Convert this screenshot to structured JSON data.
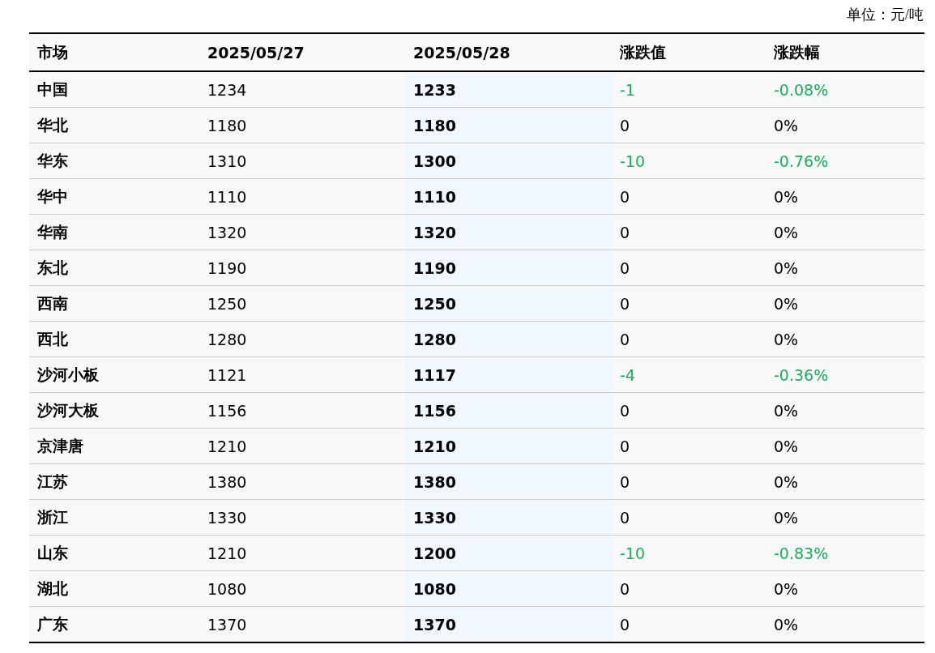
{
  "unit": "单位：元/吨",
  "columns": [
    "市场",
    "2025/05/27",
    "2025/05/28",
    "涨跌值",
    "涨跌幅"
  ],
  "rows": [
    {
      "market": "中国",
      "prev": "1234",
      "curr": "1233",
      "change": "-1",
      "pct": "-0.08%",
      "color": "#1aad5a"
    },
    {
      "market": "华北",
      "prev": "1180",
      "curr": "1180",
      "change": "0",
      "pct": "0%",
      "color": "#000000"
    },
    {
      "market": "华东",
      "prev": "1310",
      "curr": "1300",
      "change": "-10",
      "pct": "-0.76%",
      "color": "#1aad5a"
    },
    {
      "market": "华中",
      "prev": "1110",
      "curr": "1110",
      "change": "0",
      "pct": "0%",
      "color": "#000000"
    },
    {
      "market": "华南",
      "prev": "1320",
      "curr": "1320",
      "change": "0",
      "pct": "0%",
      "color": "#000000"
    },
    {
      "market": "东北",
      "prev": "1190",
      "curr": "1190",
      "change": "0",
      "pct": "0%",
      "color": "#000000"
    },
    {
      "market": "西南",
      "prev": "1250",
      "curr": "1250",
      "change": "0",
      "pct": "0%",
      "color": "#000000"
    },
    {
      "market": "西北",
      "prev": "1280",
      "curr": "1280",
      "change": "0",
      "pct": "0%",
      "color": "#000000"
    },
    {
      "market": "沙河小板",
      "prev": "1121",
      "curr": "1117",
      "change": "-4",
      "pct": "-0.36%",
      "color": "#1aad5a"
    },
    {
      "market": "沙河大板",
      "prev": "1156",
      "curr": "1156",
      "change": "0",
      "pct": "0%",
      "color": "#000000"
    },
    {
      "market": "京津唐",
      "prev": "1210",
      "curr": "1210",
      "change": "0",
      "pct": "0%",
      "color": "#000000"
    },
    {
      "market": "江苏",
      "prev": "1380",
      "curr": "1380",
      "change": "0",
      "pct": "0%",
      "color": "#000000"
    },
    {
      "market": "浙江",
      "prev": "1330",
      "curr": "1330",
      "change": "0",
      "pct": "0%",
      "color": "#000000"
    },
    {
      "market": "山东",
      "prev": "1210",
      "curr": "1200",
      "change": "-10",
      "pct": "-0.83%",
      "color": "#1aad5a"
    },
    {
      "market": "湖北",
      "prev": "1080",
      "curr": "1080",
      "change": "0",
      "pct": "0%",
      "color": "#000000"
    },
    {
      "market": "广东",
      "prev": "1370",
      "curr": "1370",
      "change": "0",
      "pct": "0%",
      "color": "#000000"
    }
  ]
}
